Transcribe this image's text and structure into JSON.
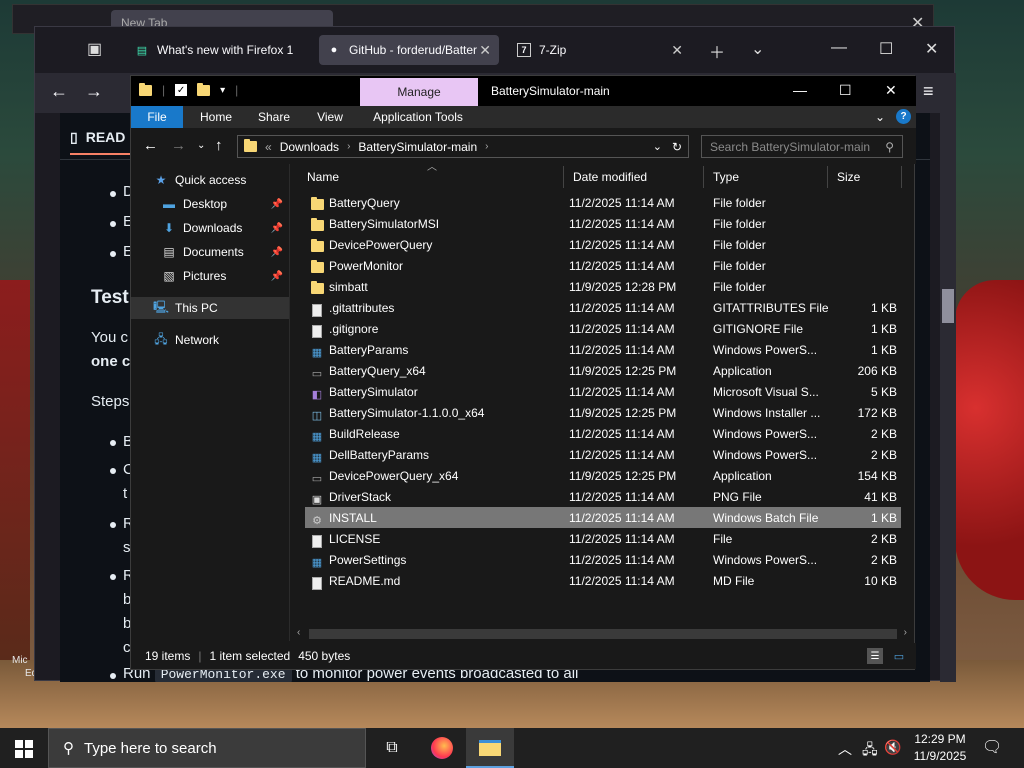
{
  "back_window": {
    "tab_label": "New Tab"
  },
  "firefox": {
    "tabs": [
      {
        "label": "What's new with Firefox 1"
      },
      {
        "label": "GitHub - forderud/Batter"
      },
      {
        "label": "7-Zip"
      }
    ],
    "readme_tab": "READ",
    "content": {
      "bullets_top": [
        "D",
        "E",
        "E"
      ],
      "heading": "Test",
      "para1": "You c",
      "para1b": "one c",
      "steps": "Steps",
      "bullets_mid": [
        "B",
        "C",
        "t",
        "R",
        "s",
        "R",
        "b",
        "b",
        "c"
      ],
      "last_line_pre": "Run",
      "last_line_code": "PowerMonitor.exe",
      "last_line_post": "to monitor power events broadcasted to all"
    }
  },
  "explorer": {
    "manage_label": "Manage",
    "window_title": "BatterySimulator-main",
    "ribbon_tabs": [
      "File",
      "Home",
      "Share",
      "View",
      "Application Tools"
    ],
    "breadcrumb": [
      "Downloads",
      "BatterySimulator-main"
    ],
    "breadcrumb_prefix": "«",
    "search_placeholder": "Search BatterySimulator-main",
    "nav": [
      {
        "label": "Quick access",
        "icon": "star-icon",
        "pinned": false
      },
      {
        "label": "Desktop",
        "icon": "desktop-icon",
        "pinned": true
      },
      {
        "label": "Downloads",
        "icon": "download-icon",
        "pinned": true
      },
      {
        "label": "Documents",
        "icon": "document-icon",
        "pinned": true
      },
      {
        "label": "Pictures",
        "icon": "picture-icon",
        "pinned": true
      },
      {
        "label": "This PC",
        "icon": "pc-icon",
        "pinned": false
      },
      {
        "label": "Network",
        "icon": "network-icon",
        "pinned": false
      }
    ],
    "columns": [
      "Name",
      "Date modified",
      "Type",
      "Size"
    ],
    "files": [
      {
        "name": "BatteryQuery",
        "date": "11/2/2025 11:14 AM",
        "type": "File folder",
        "size": "",
        "kind": "folder"
      },
      {
        "name": "BatterySimulatorMSI",
        "date": "11/2/2025 11:14 AM",
        "type": "File folder",
        "size": "",
        "kind": "folder"
      },
      {
        "name": "DevicePowerQuery",
        "date": "11/2/2025 11:14 AM",
        "type": "File folder",
        "size": "",
        "kind": "folder"
      },
      {
        "name": "PowerMonitor",
        "date": "11/2/2025 11:14 AM",
        "type": "File folder",
        "size": "",
        "kind": "folder"
      },
      {
        "name": "simbatt",
        "date": "11/9/2025 12:28 PM",
        "type": "File folder",
        "size": "",
        "kind": "folder"
      },
      {
        "name": ".gitattributes",
        "date": "11/2/2025 11:14 AM",
        "type": "GITATTRIBUTES File",
        "size": "1 KB",
        "kind": "file"
      },
      {
        "name": ".gitignore",
        "date": "11/2/2025 11:14 AM",
        "type": "GITIGNORE File",
        "size": "1 KB",
        "kind": "file"
      },
      {
        "name": "BatteryParams",
        "date": "11/2/2025 11:14 AM",
        "type": "Windows PowerS...",
        "size": "1 KB",
        "kind": "ps"
      },
      {
        "name": "BatteryQuery_x64",
        "date": "11/9/2025 12:25 PM",
        "type": "Application",
        "size": "206 KB",
        "kind": "app"
      },
      {
        "name": "BatterySimulator",
        "date": "11/2/2025 11:14 AM",
        "type": "Microsoft Visual S...",
        "size": "5 KB",
        "kind": "vs"
      },
      {
        "name": "BatterySimulator-1.1.0.0_x64",
        "date": "11/9/2025 12:25 PM",
        "type": "Windows Installer ...",
        "size": "172 KB",
        "kind": "msi"
      },
      {
        "name": "BuildRelease",
        "date": "11/2/2025 11:14 AM",
        "type": "Windows PowerS...",
        "size": "2 KB",
        "kind": "ps"
      },
      {
        "name": "DellBatteryParams",
        "date": "11/2/2025 11:14 AM",
        "type": "Windows PowerS...",
        "size": "2 KB",
        "kind": "ps"
      },
      {
        "name": "DevicePowerQuery_x64",
        "date": "11/9/2025 12:25 PM",
        "type": "Application",
        "size": "154 KB",
        "kind": "app"
      },
      {
        "name": "DriverStack",
        "date": "11/2/2025 11:14 AM",
        "type": "PNG File",
        "size": "41 KB",
        "kind": "png"
      },
      {
        "name": "INSTALL",
        "date": "11/2/2025 11:14 AM",
        "type": "Windows Batch File",
        "size": "1 KB",
        "kind": "bat",
        "selected": true
      },
      {
        "name": "LICENSE",
        "date": "11/2/2025 11:14 AM",
        "type": "File",
        "size": "2 KB",
        "kind": "file"
      },
      {
        "name": "PowerSettings",
        "date": "11/2/2025 11:14 AM",
        "type": "Windows PowerS...",
        "size": "2 KB",
        "kind": "ps"
      },
      {
        "name": "README.md",
        "date": "11/2/2025 11:14 AM",
        "type": "MD File",
        "size": "10 KB",
        "kind": "file"
      }
    ],
    "status": {
      "items": "19 items",
      "selected": "1 item selected",
      "bytes": "450 bytes"
    }
  },
  "taskbar": {
    "search_placeholder": "Type here to search",
    "time": "12:29 PM",
    "date": "11/9/2025"
  },
  "desktop_text": {
    "left1": "Mic",
    "left2": "Ed"
  }
}
